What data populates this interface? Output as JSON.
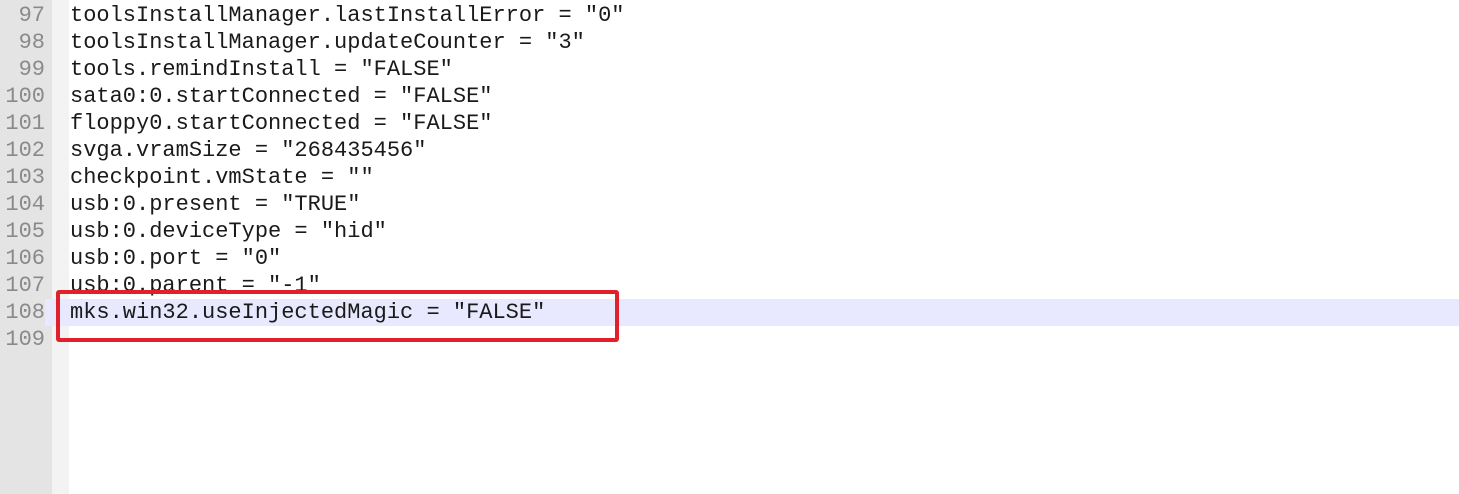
{
  "editor": {
    "lines": [
      {
        "number": "97",
        "text": "toolsInstallManager.lastInstallError = \"0\""
      },
      {
        "number": "98",
        "text": "toolsInstallManager.updateCounter = \"3\""
      },
      {
        "number": "99",
        "text": "tools.remindInstall = \"FALSE\""
      },
      {
        "number": "100",
        "text": "sata0:0.startConnected = \"FALSE\""
      },
      {
        "number": "101",
        "text": "floppy0.startConnected = \"FALSE\""
      },
      {
        "number": "102",
        "text": "svga.vramSize = \"268435456\""
      },
      {
        "number": "103",
        "text": "checkpoint.vmState = \"\""
      },
      {
        "number": "104",
        "text": "usb:0.present = \"TRUE\""
      },
      {
        "number": "105",
        "text": "usb:0.deviceType = \"hid\""
      },
      {
        "number": "106",
        "text": "usb:0.port = \"0\""
      },
      {
        "number": "107",
        "text": "usb:0.parent = \"-1\""
      },
      {
        "number": "108",
        "text": "mks.win32.useInjectedMagic = \"FALSE\""
      },
      {
        "number": "109",
        "text": ""
      }
    ],
    "current_line": "108",
    "highlight_color": "#e0202a",
    "current_line_color": "#e8e8ff"
  }
}
